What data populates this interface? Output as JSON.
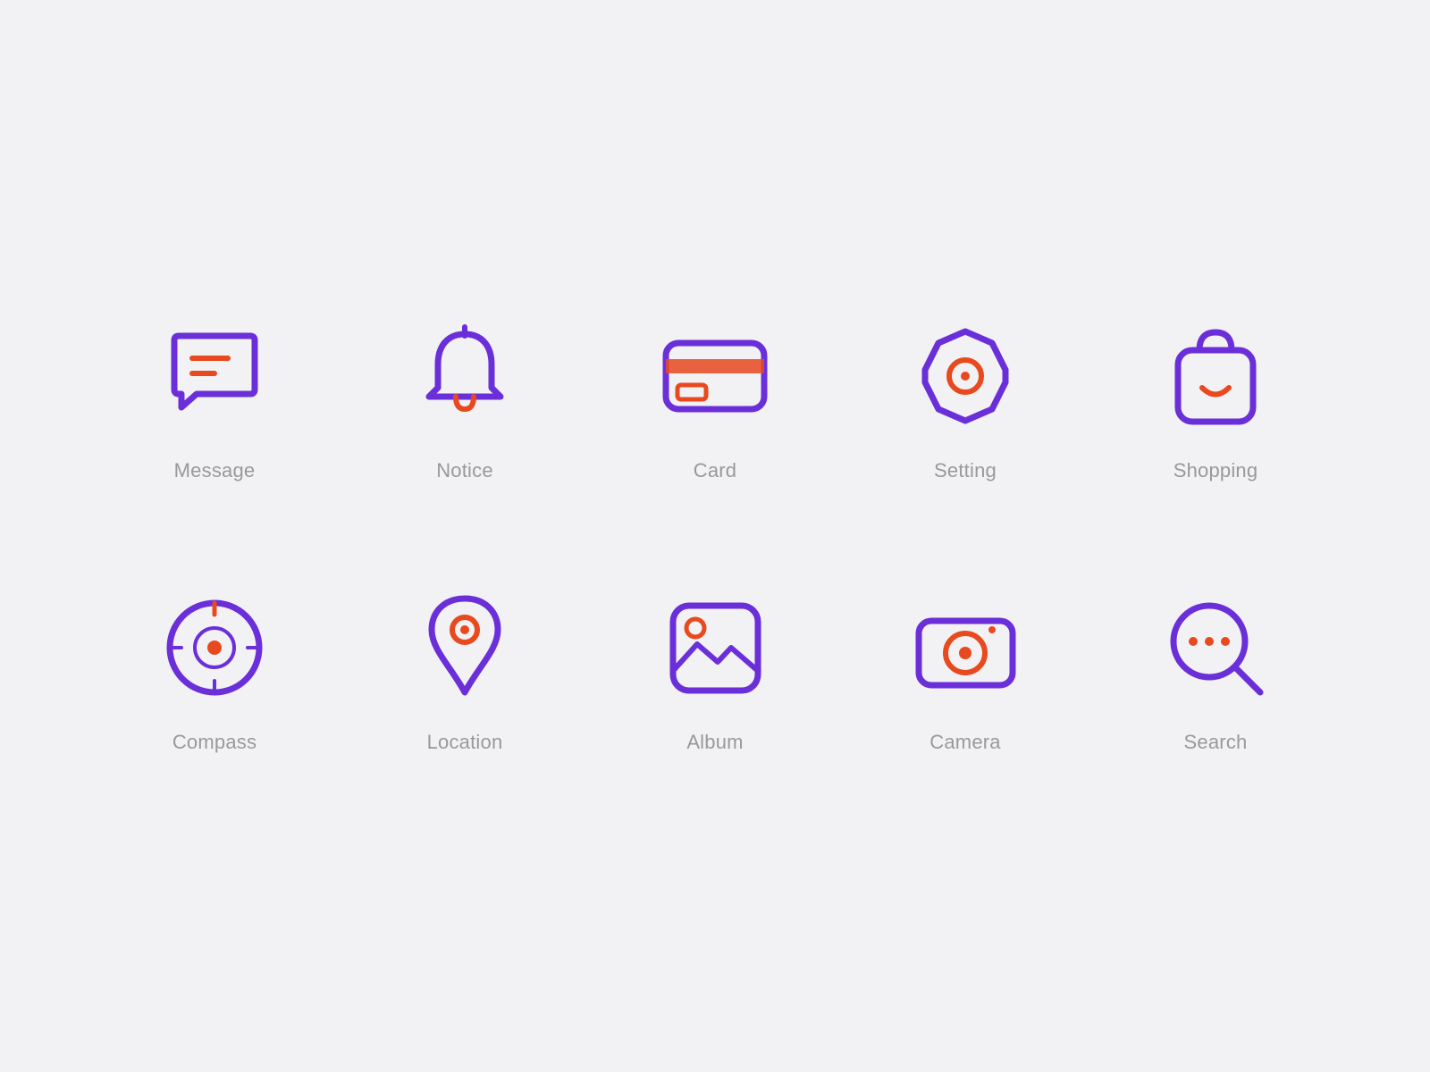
{
  "colors": {
    "purple": "#6B2FD9",
    "orange": "#E8491E",
    "bg": "#f2f2f5"
  },
  "icons": [
    {
      "id": "message",
      "label": "Message"
    },
    {
      "id": "notice",
      "label": "Notice"
    },
    {
      "id": "card",
      "label": "Card"
    },
    {
      "id": "setting",
      "label": "Setting"
    },
    {
      "id": "shopping",
      "label": "Shopping"
    },
    {
      "id": "compass",
      "label": "Compass"
    },
    {
      "id": "location",
      "label": "Location"
    },
    {
      "id": "album",
      "label": "Album"
    },
    {
      "id": "camera",
      "label": "Camera"
    },
    {
      "id": "search",
      "label": "Search"
    }
  ]
}
